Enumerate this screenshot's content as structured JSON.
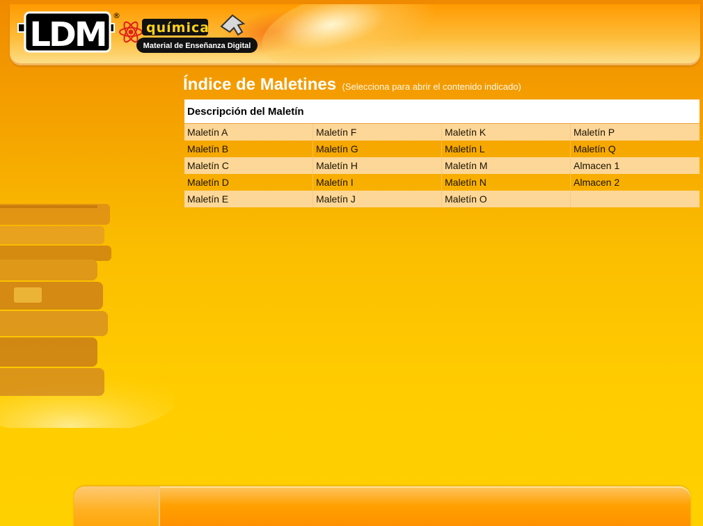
{
  "header": {
    "logo": {
      "brand": "LDM",
      "registered": "®",
      "subject": "química",
      "tagline": "Material de Enseñanza Digital"
    }
  },
  "page": {
    "title": "Índice de Maletines",
    "subtitle": "(Selecciona para abrir el contenido indicado)"
  },
  "table": {
    "header": "Descripción del Maletín",
    "rows": [
      [
        "Maletín A",
        "Maletín F",
        "Maletín K",
        "Maletín P"
      ],
      [
        "Maletín B",
        "Maletín G",
        "Maletín L",
        "Maletín Q"
      ],
      [
        "Maletín C",
        "Maletín H",
        "Maletín M",
        "Almacen 1"
      ],
      [
        "Maletín D",
        "Maletín I",
        "Maletín N",
        "Almacen 2"
      ],
      [
        "Maletín E",
        "Maletín J",
        "Maletín O",
        ""
      ]
    ]
  },
  "colors": {
    "background_top": "#f08a00",
    "background_bottom": "#ffd000",
    "row_light": "#fdd798",
    "header_bg": "#ffffff",
    "logo_red": "#e0201a",
    "logo_yellow": "#ffd21a"
  }
}
